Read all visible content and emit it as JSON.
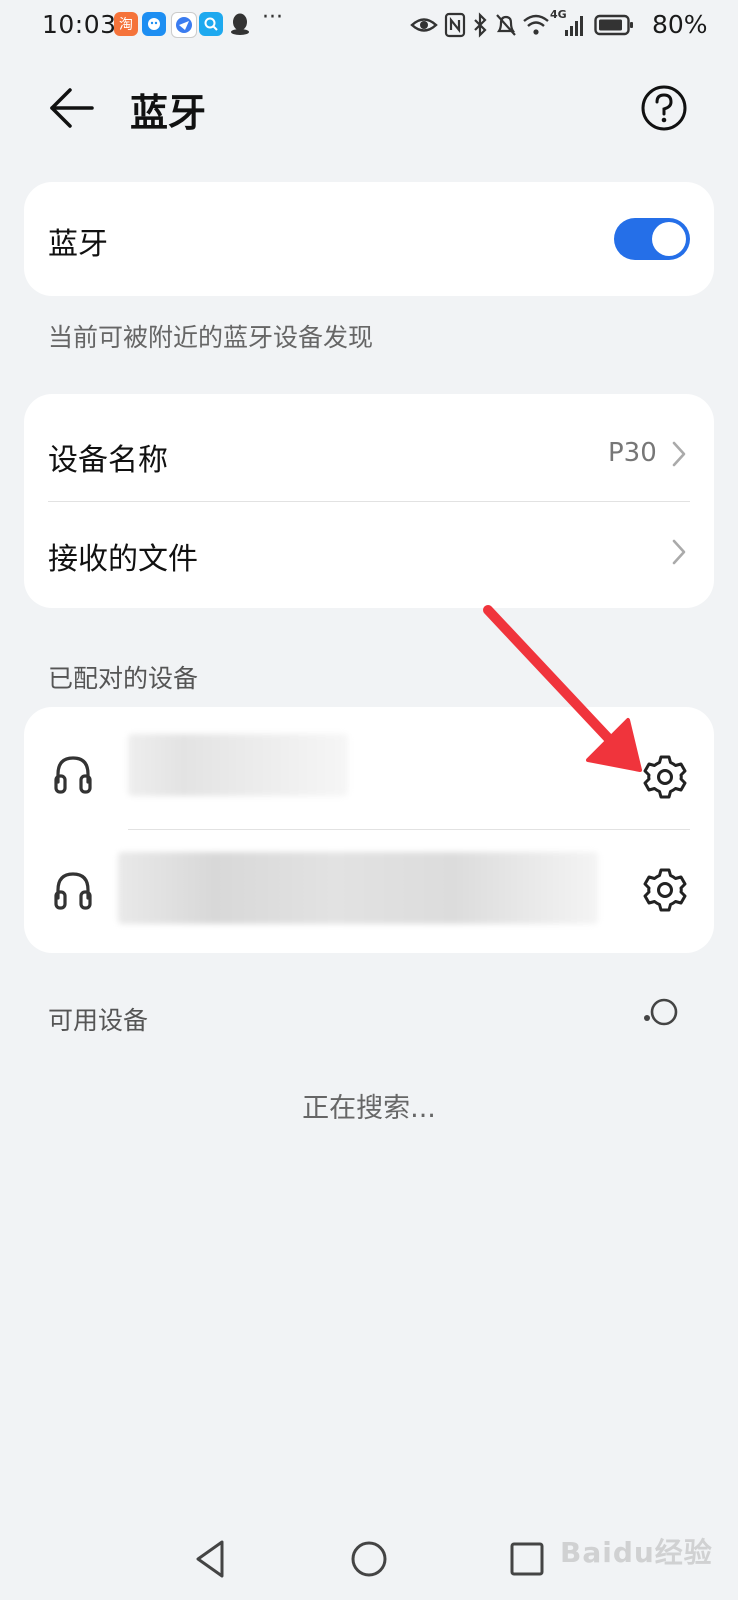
{
  "status_bar": {
    "time": "10:03",
    "battery": "80%",
    "more": "···",
    "network": "4G"
  },
  "header": {
    "title": "蓝牙"
  },
  "bluetooth": {
    "label": "蓝牙",
    "enabled": true,
    "toggle_color": "#256fe8",
    "visibility_hint": "当前可被附近的蓝牙设备发现"
  },
  "device_settings": {
    "device_name_label": "设备名称",
    "device_name_value": "P30",
    "received_files_label": "接收的文件"
  },
  "paired": {
    "header": "已配对的设备",
    "devices": [
      {
        "icon": "headset-icon",
        "name": ""
      },
      {
        "icon": "headset-icon",
        "name": ""
      }
    ]
  },
  "available": {
    "header": "可用设备",
    "searching": "正在搜索..."
  },
  "watermark": "Baidu经验"
}
